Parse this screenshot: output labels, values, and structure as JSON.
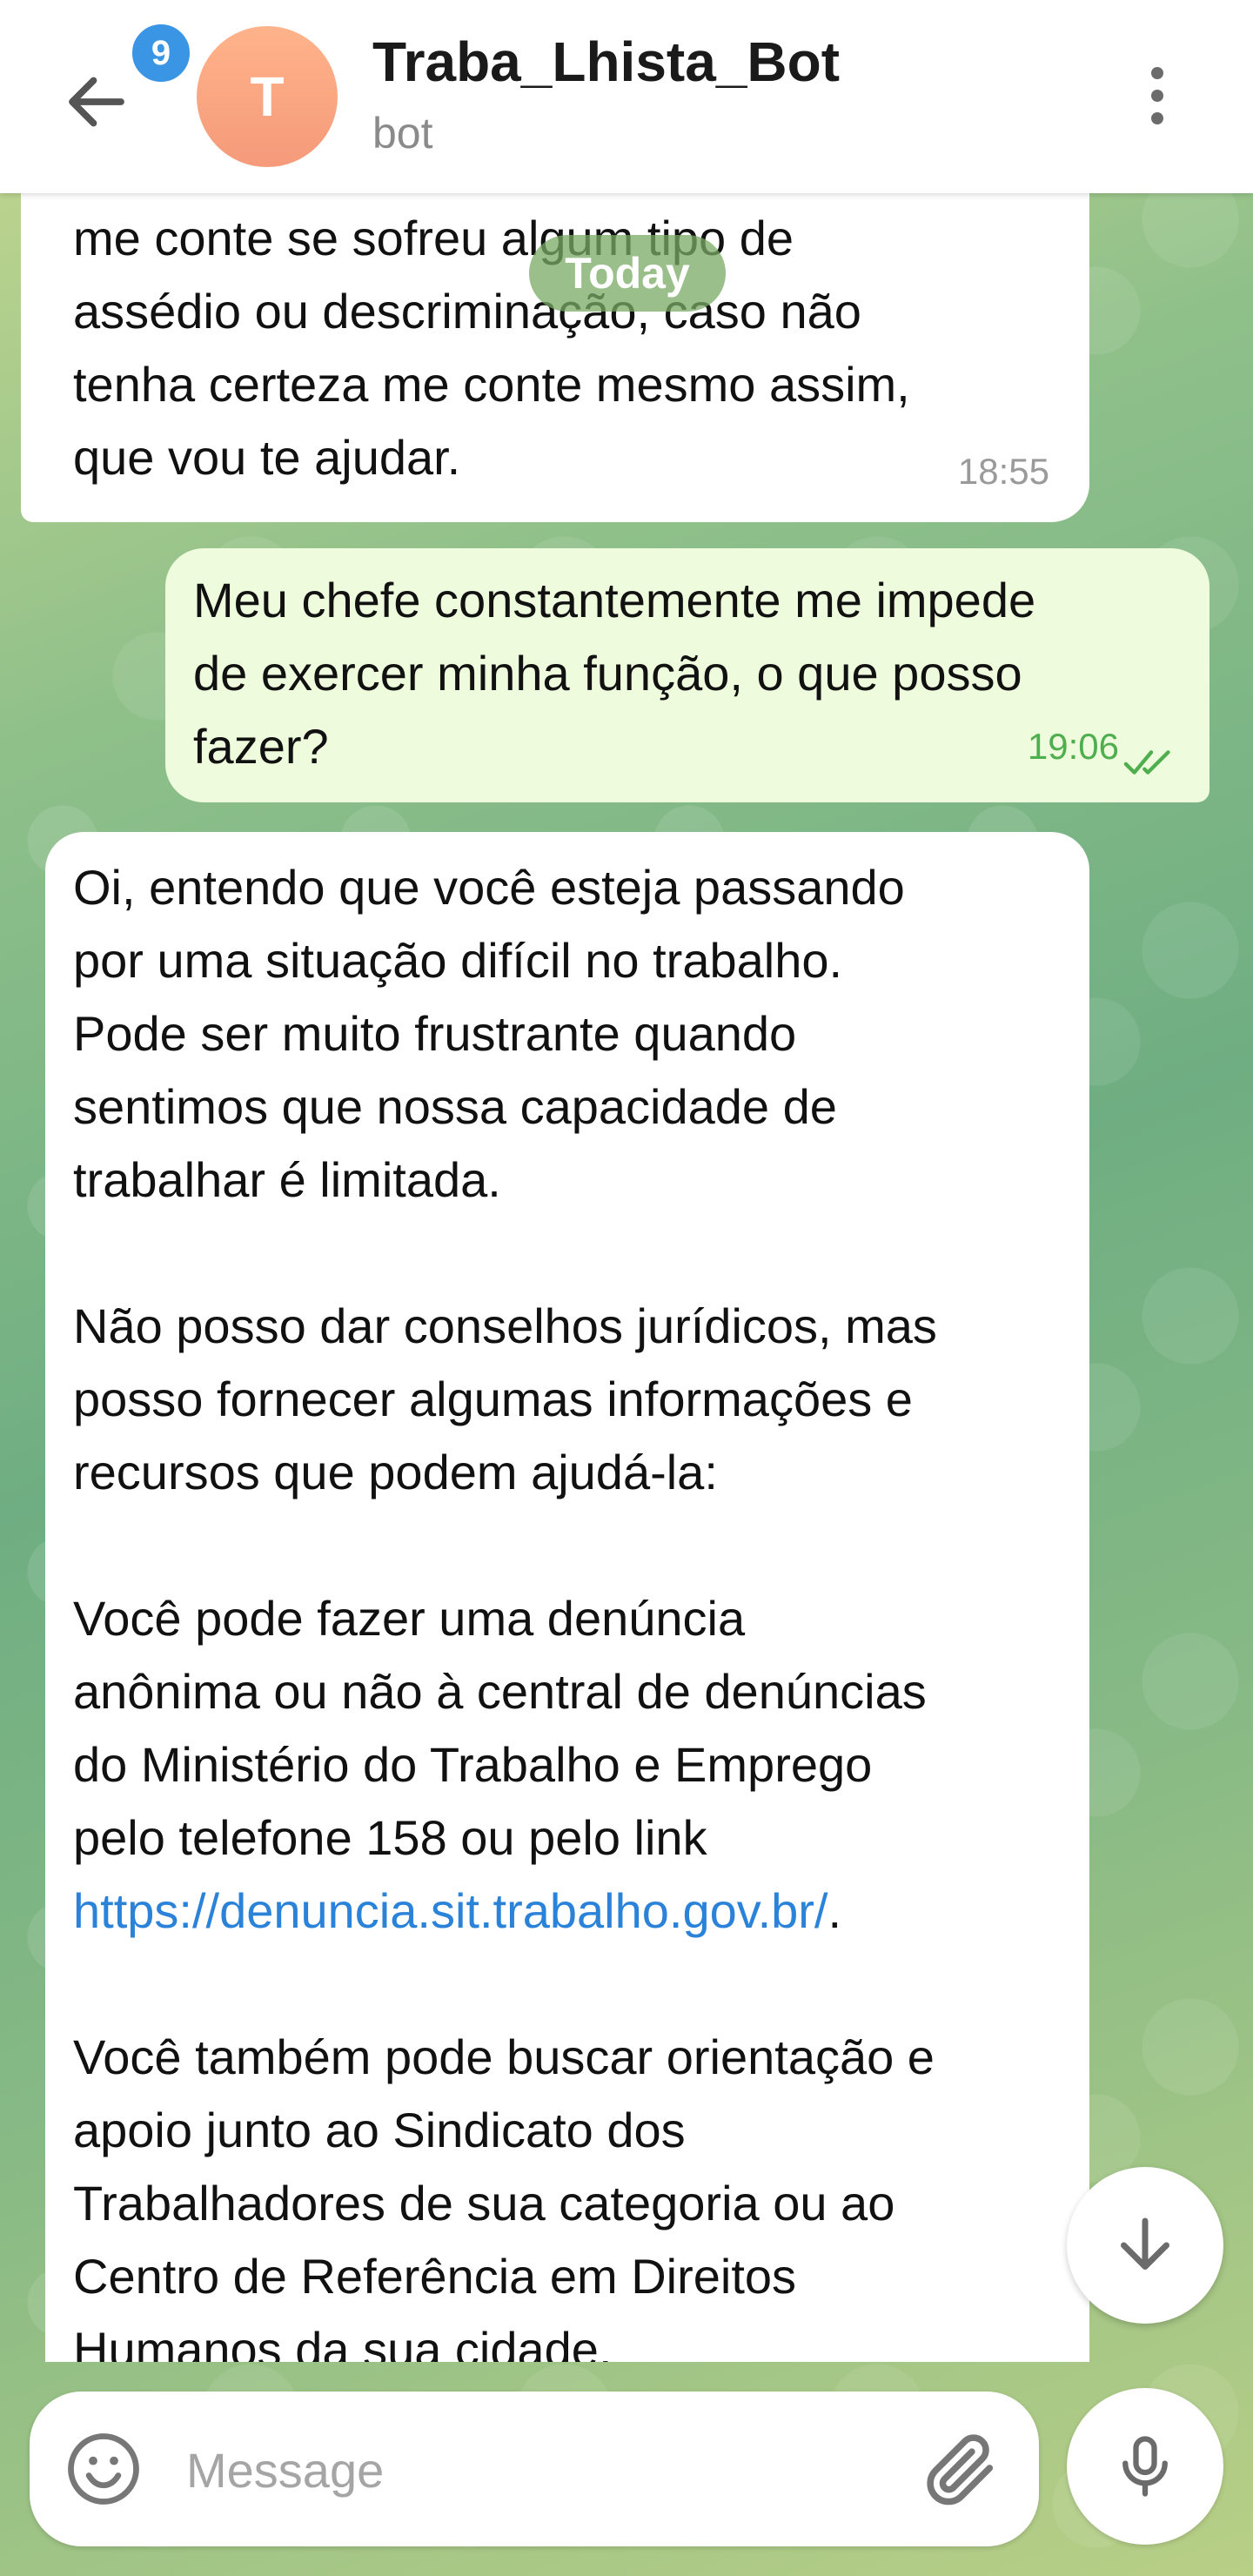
{
  "header": {
    "back_label": "back",
    "unread_count": "9",
    "avatar_letter": "T",
    "title": "Traba_Lhista_Bot",
    "subtitle": "bot"
  },
  "chat": {
    "date_separator": "Today",
    "messages": [
      {
        "direction": "incoming",
        "text": "me conte se sofreu algum tipo de\nassédio ou descriminação, caso não\ntenha certeza me conte mesmo assim,\nque vou te ajudar.",
        "time": "18:55"
      },
      {
        "direction": "outgoing",
        "text": "Meu chefe constantemente me impede\nde exercer minha função, o que posso\nfazer?",
        "time": "19:06",
        "status": "read"
      },
      {
        "direction": "incoming",
        "p1": "Oi, entendo que você esteja passando\npor uma situação difícil no trabalho.\nPode ser muito frustrante quando\nsentimos que nossa capacidade de\ntrabalhar é limitada.",
        "p2": "Não posso dar conselhos jurídicos, mas\nposso fornecer algumas informações e\nrecursos que podem ajudá-la:",
        "p3": "Você pode fazer uma denúncia\nanônima ou não à central de denúncias\ndo Ministério do Trabalho e Emprego\npelo telefone 158 ou pelo link\n",
        "link": "https://denuncia.sit.trabalho.gov.br/",
        "link_suffix": ".",
        "p4": "Você também pode buscar orientação e\napoio junto ao Sindicato dos\nTrabalhadores de sua categoria ou ao\nCentro de Referência em Direitos\nHumanos da sua cidade."
      }
    ]
  },
  "composer": {
    "placeholder": "Message"
  },
  "colors": {
    "accent": "#3a95e5",
    "outgoing_bubble": "#eefbdc",
    "read_check": "#4fae4e",
    "link": "#2b82d9"
  },
  "icons": [
    "back-arrow-icon",
    "more-vertical-icon",
    "double-check-icon",
    "arrow-down-icon",
    "emoji-icon",
    "paperclip-icon",
    "microphone-icon"
  ]
}
